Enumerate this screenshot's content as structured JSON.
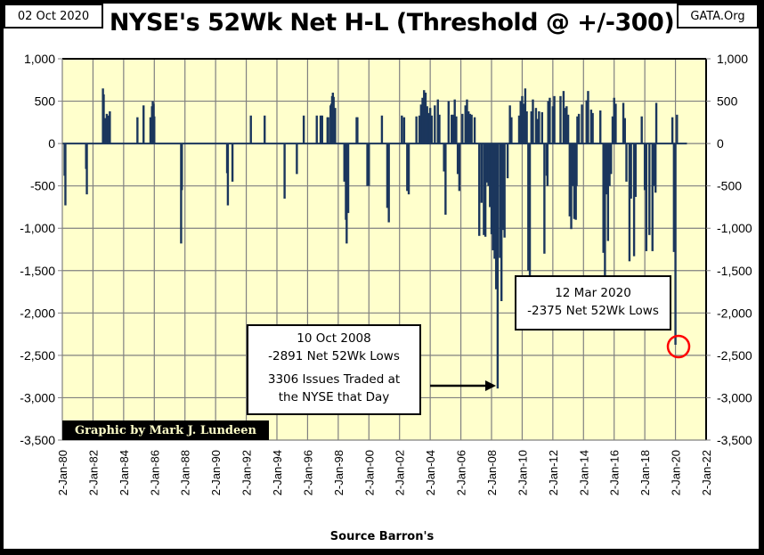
{
  "header": {
    "date": "02 Oct 2020",
    "site": "GATA.Org"
  },
  "footer": {
    "source": "Source Barron's",
    "credit": "Graphic by Mark J. Lundeen"
  },
  "annotations": [
    {
      "lines": [
        "10 Oct 2008",
        "-2891 Net 52Wk Lows",
        "3306 Issues Traded at",
        "the NYSE that Day"
      ]
    },
    {
      "lines": [
        "12 Mar 2020",
        "-2375 Net 52Wk Lows"
      ]
    }
  ],
  "colors": {
    "bar": "#1b365d",
    "plot_bg": "#ffffcc",
    "grid": "#808080",
    "circle": "#ff0000"
  },
  "chart_data": {
    "type": "bar",
    "title": "NYSE's 52Wk Net H-L (Threshold @ +/-300)",
    "xlabel": "Source Barron's",
    "ylabel": "",
    "ylim": [
      -3500,
      1000
    ],
    "yticks": [
      1000,
      500,
      0,
      -500,
      -1000,
      -1500,
      -2000,
      -2500,
      -3000,
      -3500
    ],
    "ytick_labels": [
      "1,000",
      "500",
      "0",
      "-500",
      "-1,000",
      "-1,500",
      "-2,000",
      "-2,500",
      "-3,000",
      "-3,500"
    ],
    "xlim": [
      1980,
      2022
    ],
    "xtick_labels": [
      "2-Jan-80",
      "2-Jan-82",
      "2-Jan-84",
      "2-Jan-86",
      "2-Jan-88",
      "2-Jan-90",
      "2-Jan-92",
      "2-Jan-94",
      "2-Jan-96",
      "2-Jan-98",
      "2-Jan-00",
      "2-Jan-02",
      "2-Jan-04",
      "2-Jan-06",
      "2-Jan-08",
      "2-Jan-10",
      "2-Jan-12",
      "2-Jan-14",
      "2-Jan-16",
      "2-Jan-18",
      "2-Jan-20",
      "2-Jan-22"
    ],
    "grid": true,
    "secondary_y_axis": true,
    "series": [
      {
        "name": "NYSE 52Wk Net H-L",
        "x": [
          1980.15,
          1980.2,
          1981.55,
          1981.6,
          1982.65,
          1982.7,
          1982.8,
          1982.9,
          1983.0,
          1983.1,
          1984.9,
          1985.3,
          1985.75,
          1985.85,
          1985.9,
          1985.95,
          1986.0,
          1987.75,
          1987.8,
          1988.3,
          1990.75,
          1990.8,
          1991.1,
          1992.3,
          1993.2,
          1993.55,
          1993.85,
          1994.5,
          1995.3,
          1995.75,
          1996.6,
          1996.85,
          1996.95,
          1997.3,
          1997.35,
          1997.5,
          1997.55,
          1997.6,
          1997.65,
          1997.7,
          1997.8,
          1998.4,
          1998.5,
          1998.55,
          1998.6,
          1998.65,
          1999.2,
          1999.25,
          1999.9,
          2000.0,
          2000.85,
          2001.2,
          2001.3,
          2001.5,
          2002.15,
          2002.3,
          2002.5,
          2002.6,
          2003.1,
          2003.3,
          2003.4,
          2003.5,
          2003.6,
          2003.7,
          2003.8,
          2003.9,
          2004.0,
          2004.1,
          2004.3,
          2004.5,
          2004.6,
          2004.9,
          2005.0,
          2005.2,
          2005.4,
          2005.5,
          2005.6,
          2005.7,
          2005.8,
          2005.9,
          2006.1,
          2006.3,
          2006.4,
          2006.5,
          2006.6,
          2006.7,
          2006.9,
          2007.2,
          2007.35,
          2007.5,
          2007.6,
          2007.7,
          2007.8,
          2007.9,
          2008.0,
          2008.1,
          2008.2,
          2008.3,
          2008.4,
          2008.55,
          2008.65,
          2008.75,
          2008.78,
          2008.85,
          2009.05,
          2009.2,
          2009.3,
          2009.8,
          2009.9,
          2010.0,
          2010.1,
          2010.2,
          2010.3,
          2010.4,
          2010.5,
          2010.6,
          2010.7,
          2010.9,
          2011.0,
          2011.1,
          2011.3,
          2011.45,
          2011.6,
          2011.65,
          2011.7,
          2011.8,
          2012.0,
          2012.1,
          2012.5,
          2012.7,
          2012.8,
          2012.9,
          2013.0,
          2013.1,
          2013.2,
          2013.3,
          2013.4,
          2013.5,
          2013.55,
          2013.6,
          2013.7,
          2013.9,
          2014.2,
          2014.3,
          2014.5,
          2014.6,
          2015.1,
          2015.3,
          2015.4,
          2015.5,
          2015.6,
          2015.7,
          2015.8,
          2015.9,
          2016.0,
          2016.1,
          2016.6,
          2016.7,
          2016.8,
          2017.0,
          2017.1,
          2017.3,
          2017.4,
          2017.8,
          2018.0,
          2018.1,
          2018.3,
          2018.5,
          2018.6,
          2018.7,
          2018.75,
          2019.8,
          2019.9,
          2020.0,
          2020.1,
          2020.2,
          2020.3,
          2020.75
        ],
        "values": [
          -380,
          -730,
          -300,
          -600,
          650,
          580,
          300,
          350,
          330,
          380,
          310,
          450,
          310,
          440,
          500,
          470,
          320,
          -1180,
          -550,
          0,
          -350,
          -730,
          -450,
          330,
          330,
          0,
          0,
          -650,
          -360,
          330,
          330,
          330,
          330,
          310,
          310,
          450,
          470,
          560,
          600,
          550,
          420,
          -450,
          -900,
          -1180,
          -680,
          -820,
          310,
          310,
          -500,
          -500,
          330,
          -760,
          -930,
          0,
          330,
          310,
          -560,
          -600,
          320,
          330,
          460,
          540,
          630,
          600,
          440,
          360,
          420,
          330,
          450,
          520,
          340,
          -330,
          -840,
          500,
          340,
          340,
          520,
          320,
          -360,
          -560,
          350,
          450,
          520,
          380,
          350,
          340,
          310,
          -1090,
          -700,
          -1080,
          -1100,
          -460,
          -500,
          -750,
          -1070,
          -1260,
          -1360,
          -1720,
          -2891,
          -1350,
          -1860,
          -1020,
          -590,
          -1110,
          -410,
          450,
          310,
          330,
          500,
          560,
          470,
          650,
          380,
          -1500,
          -1700,
          380,
          520,
          420,
          290,
          380,
          370,
          -1300,
          -380,
          -500,
          500,
          540,
          440,
          560,
          560,
          620,
          420,
          440,
          340,
          -860,
          -1010,
          -500,
          -890,
          -900,
          -500,
          320,
          350,
          460,
          510,
          620,
          400,
          360,
          390,
          -1290,
          -1570,
          -600,
          -1150,
          -500,
          -360,
          320,
          540,
          470,
          480,
          300,
          -450,
          -1390,
          -650,
          -1330,
          -630,
          320,
          -550,
          -1270,
          -1080,
          -1270,
          -500,
          -580,
          480,
          310,
          -1280,
          -2375,
          340,
          0
        ]
      }
    ]
  }
}
